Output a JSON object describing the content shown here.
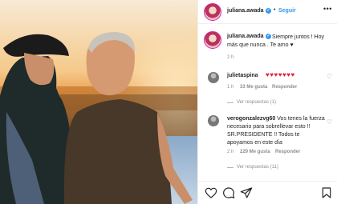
{
  "header": {
    "username": "juliana.awada",
    "separator": "•",
    "follow_label": "Seguir",
    "more_icon": "•••"
  },
  "caption": {
    "username": "juliana.awada",
    "text": "Siempre juntos ! Hoy más que nunca . Te amo ♥",
    "time": "2 h"
  },
  "comments": [
    {
      "username": "julietaspina",
      "hearts": "♥♥♥♥♥♥♥",
      "time": "1 h",
      "likes": "33 Me gusta",
      "reply": "Responder",
      "view_replies": "Ver respuestas (1)"
    },
    {
      "username": "verogonzalezvg60",
      "text": "Vos tenes la fuerza necesario para sobrellevar esto !! SR.PRESIDENTE !! Todos te apoyamos en este día",
      "time": "2 h",
      "likes": "229 Me gusta",
      "reply": "Responder",
      "view_replies": "Ver respuestas (11)"
    }
  ],
  "colors": {
    "accent": "#3897f0",
    "verified": "#3897f0",
    "heart_red": "#e21b3a"
  }
}
